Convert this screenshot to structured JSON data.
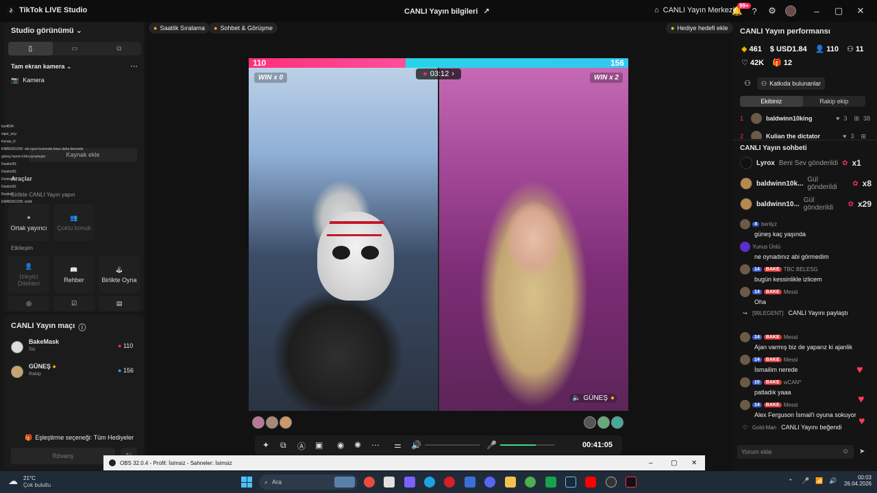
{
  "titlebar": {
    "app_name": "TikTok LIVE Studio",
    "center_title": "CANLI Yayın bilgileri",
    "live_center": "CANLI Yayın Merkezi",
    "notif_count": "99+"
  },
  "left": {
    "studio_view": "Studio görünümü",
    "source": "Tam ekran kamera",
    "camera": "Kamera",
    "add_source": "Kaynak ekle",
    "tools": "Araçlar",
    "collab_title": "Birlikte CANLI Yayın yapın",
    "co_host": "Ortak yayıncı",
    "multi_guest": "Çoklu konuk",
    "interaction": "Etkileşim",
    "viewer_requests": "İzleyici Dilekleri",
    "guide": "Rehber",
    "play_together": "Birlikte Oyna",
    "match_title": "CANLI Yayın maçı",
    "player1": {
      "name": "BakeMask",
      "role": "Siz",
      "score": "110"
    },
    "player2": {
      "name": "GÜNEŞ",
      "role": "Rakip",
      "score": "156"
    },
    "match_option": "Eşleştirme seçeneği: Tüm Hediyeler",
    "rematch": "Rövanş",
    "overlay_chat": [
      "lso4834:",
      "viper_ony:",
      "Kenan_0:",
      "EMRE551255: abi oyun kısmında biraz daha bencede",
      "güneş hanım kötü oynamıştır",
      "Destrix35:",
      "Destrix35:",
      "Destrix35:",
      "Destrix35:",
      "Rostim:",
      "EMRE551255: sictik"
    ]
  },
  "chips": {
    "hourly_rank": "Saatlik Sıralama",
    "chat_meet": "Sohbet & Görüşme",
    "gift_goal": "Hediye hedefi ekle"
  },
  "battle": {
    "score_left": "110",
    "score_right": "156",
    "score_share_left": 0.414,
    "win_left": "WIN x 0",
    "win_right": "WIN x 2",
    "timer": "03:12",
    "opponent_name": "GÜNEŞ"
  },
  "controls": {
    "elapsed": "00:41:05",
    "mic_level": 0.65
  },
  "right": {
    "perf_title": "CANLI Yayın performansı",
    "stats": [
      "461",
      "USD1.84",
      "110",
      "11",
      "42K",
      "12"
    ],
    "contributors": "Katkıda bulunanlar",
    "tab_our": "Ekibiniz",
    "tab_rival": "Rakip ekip",
    "rank_rows": [
      {
        "rank": "1",
        "name": "baldwinn10king",
        "likes": "3",
        "score": "38"
      },
      {
        "rank": "2",
        "name": "Kulian the dictator",
        "likes": "3",
        "score": ""
      }
    ],
    "chat_title": "CANLI Yayın sohbeti",
    "gifts": [
      {
        "user": "Lyrox",
        "text": "Beni Sev gönderildi",
        "count": "x1"
      },
      {
        "user": "baldwinn10k...",
        "text": "Gül gönderildi",
        "count": "x8"
      },
      {
        "user": "baldwinn10...",
        "text": "Gül gönderildi",
        "count": "x29"
      }
    ],
    "messages": [
      {
        "level": "4",
        "team": "",
        "user": "berliyz",
        "text": "güneş kaç yaşında"
      },
      {
        "level": "",
        "team": "",
        "user": "Yunus Ünlü",
        "text": "ne oynadınız abi görmedim"
      },
      {
        "level": "14",
        "team": "BAKE",
        "user": "TBC BELESG",
        "text": "bugün kessinlikle izlicem"
      },
      {
        "level": "14",
        "team": "BAKE",
        "user": "Messi",
        "text": "Oha"
      },
      {
        "level": "",
        "team": "",
        "user": "[99LEGENT]",
        "text": "CANLI Yayını paylaştı"
      },
      {
        "level": "14",
        "team": "BAKE",
        "user": "Messi",
        "text": "Ajan varmış biz de yaparız ki ajanlik"
      },
      {
        "level": "14",
        "team": "BAKE",
        "user": "Messi",
        "text": "İsmailim nerede"
      },
      {
        "level": "10",
        "team": "BAKE",
        "user": "wCAN*",
        "text": "patladık yaaa"
      },
      {
        "level": "14",
        "team": "BAKE",
        "user": "Messi",
        "text": "Alex Ferguson İsmail'i oyuna sokuyor"
      },
      {
        "level": "",
        "team": "",
        "user": "Gold-Man",
        "text": "CANLI Yayını beğendi"
      }
    ],
    "comment_placeholder": "Yorum ekle"
  },
  "obs": {
    "title": "OBS 32.0.4 - Profil: İsimsiz - Sahneler: İsimsiz"
  },
  "taskbar": {
    "weather_temp": "21°C",
    "weather_desc": "Çok bulutlu",
    "search": "Ara",
    "time": "00:03",
    "date": "26.04.2026"
  },
  "colors": {
    "accent_pink": "#fe2c55",
    "accent_cyan": "#25f4ee",
    "level_blue": "#3a59c6"
  }
}
